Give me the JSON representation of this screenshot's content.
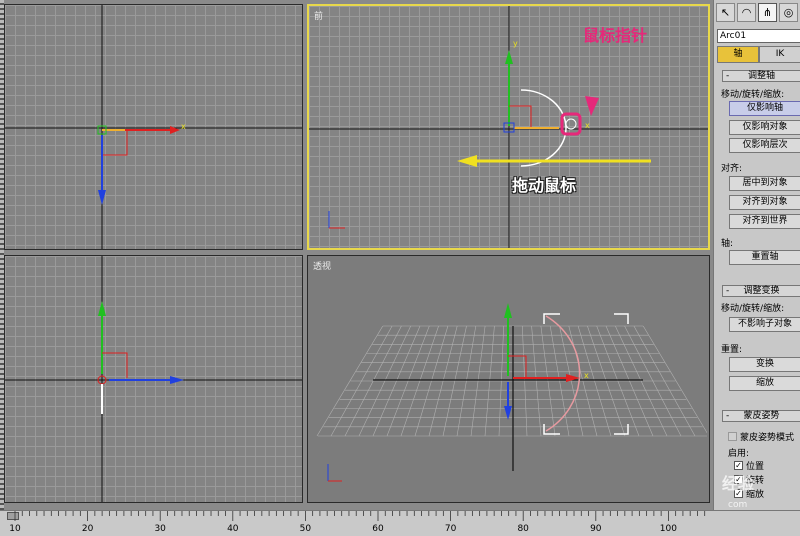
{
  "viewports": {
    "front_label": "前",
    "persp_label": "透视",
    "axis_x": "x",
    "axis_y": "y"
  },
  "annotations": {
    "pointer": "鼠标指针",
    "drag": "拖动鼠标"
  },
  "panel": {
    "tabs": [
      "pointer-icon",
      "arc-icon",
      "hierarchy-icon",
      "motion-icon"
    ],
    "object_name": "Arc01",
    "subtabs": [
      "轴",
      "IK"
    ],
    "adjust_pivot": {
      "title": "调整轴",
      "move_group": "移动/旋转/缩放:",
      "buttons": [
        "仅影响轴",
        "仅影响对象",
        "仅影响层次"
      ]
    },
    "align": {
      "group": "对齐:",
      "buttons": [
        "居中到对象",
        "对齐到对象",
        "对齐到世界"
      ]
    },
    "pivot": {
      "group": "轴:",
      "reset": "重置轴"
    },
    "adjust_transform": {
      "title": "调整变换",
      "move_group": "移动/旋转/缩放:",
      "no_children": "不影响子对象",
      "reset_group": "重置:",
      "transform": "变换",
      "scale": "缩放"
    },
    "skin_pose": {
      "title": "蒙皮姿势",
      "mode": "蒙皮姿势模式",
      "enable": "启用:",
      "position": "位置",
      "rotation": "旋转",
      "scale": "缩放"
    }
  },
  "ruler": {
    "labels": [
      "10",
      "20",
      "30",
      "40",
      "50",
      "60",
      "70",
      "80",
      "90",
      "100"
    ]
  },
  "watermark": "经验",
  "watermark_url": "com",
  "colors": {
    "active_border": "#e8d84a",
    "x_axis": "#e02020",
    "y_axis": "#20c020",
    "z_axis": "#2040e0",
    "annotation": "#e6287a",
    "drag_arrow": "#f0e020"
  }
}
